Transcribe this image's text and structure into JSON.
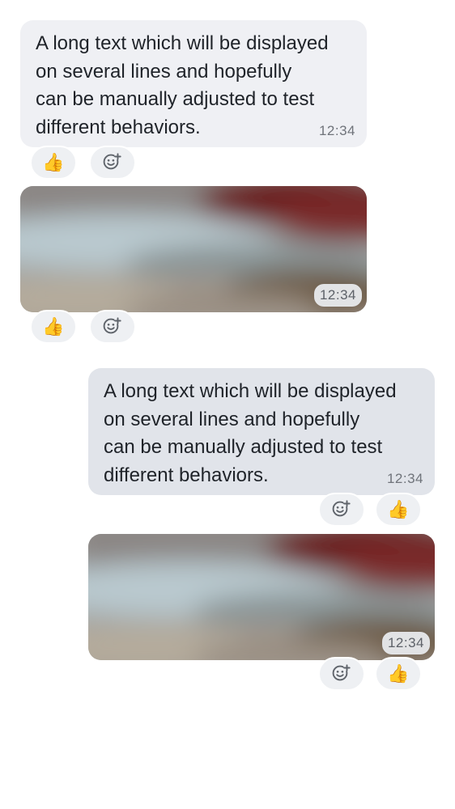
{
  "colors": {
    "incoming_bubble": "#eff0f4",
    "outgoing_bubble": "#e1e4ea",
    "timestamp": "#6f737a",
    "reaction_pill": "#eef0f3"
  },
  "icons": {
    "reaction_emoji": "thumbs-up",
    "add_reaction": "add-reaction-smiley-plus"
  },
  "messages": [
    {
      "direction": "incoming",
      "type": "text",
      "body": "A long text which will be displayed\non several lines and hopefully\ncan be manually adjusted to test\ndifferent behaviors.",
      "time": "12:34",
      "reactions": [
        {
          "emoji": "👍"
        }
      ]
    },
    {
      "direction": "incoming",
      "type": "image",
      "time": "12:34",
      "reactions": [
        {
          "emoji": "👍"
        }
      ]
    },
    {
      "direction": "outgoing",
      "type": "text",
      "body": "A long text which will be displayed\non several lines and hopefully\ncan be manually adjusted to test\ndifferent behaviors.",
      "time": "12:34",
      "reactions": [
        {
          "emoji": "👍"
        }
      ]
    },
    {
      "direction": "outgoing",
      "type": "image",
      "time": "12:34",
      "reactions": [
        {
          "emoji": "👍"
        }
      ]
    }
  ]
}
